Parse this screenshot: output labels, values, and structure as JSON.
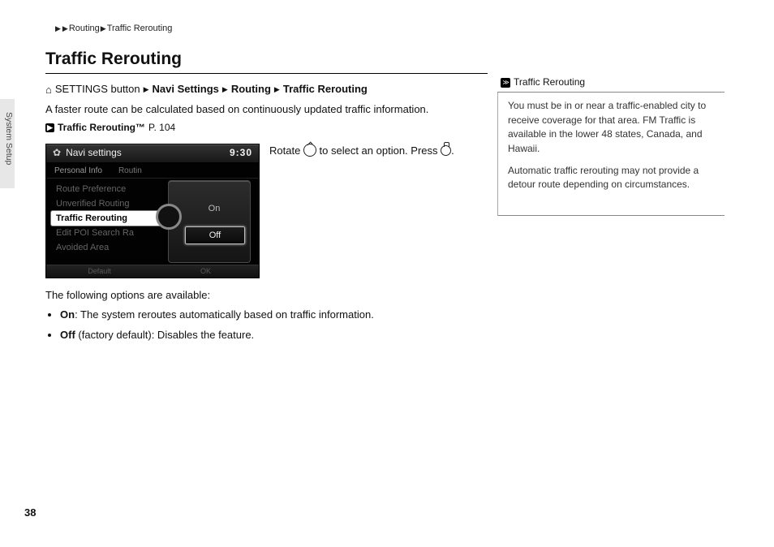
{
  "breadcrumb": {
    "item1": "Routing",
    "item2": "Traffic Rerouting"
  },
  "side_tab": "System Setup",
  "page_number": "38",
  "title": "Traffic Rerouting",
  "nav_path": {
    "settings_label": "SETTINGS button",
    "s1": "Navi Settings",
    "s2": "Routing",
    "s3": "Traffic Rerouting"
  },
  "faster_route": "A faster route can be calculated based on continuously updated traffic information.",
  "xref_label": "Traffic Rerouting™",
  "xref_page": "P. 104",
  "screenshot": {
    "title": "Navi settings",
    "clock": "9:30",
    "tab1": "Personal Info",
    "tab2": "Routin",
    "menu": {
      "m0": "Route Preference",
      "m1": "Unverified Routing",
      "m2": "Traffic Rerouting",
      "m3": "Edit POI Search Ra",
      "m4": "Avoided Area"
    },
    "popup_on": "On",
    "popup_off": "Off",
    "footer_left": "Default",
    "footer_right": "OK"
  },
  "shot_side_a": "Rotate ",
  "shot_side_b": " to select an option. Press ",
  "shot_side_c": ".",
  "options_intro": "The following options are available:",
  "opt_on_label": "On",
  "opt_on_text": ": The system reroutes automatically based on traffic information.",
  "opt_off_label": "Off",
  "opt_off_text": " (factory default): Disables the feature.",
  "sidebar": {
    "heading": "Traffic Rerouting",
    "p1": "You must be in or near a traffic-enabled city to receive coverage for that area. FM Traffic is available in the lower 48 states, Canada, and Hawaii.",
    "p2": "Automatic traffic rerouting may not provide a detour route depending on circumstances."
  }
}
